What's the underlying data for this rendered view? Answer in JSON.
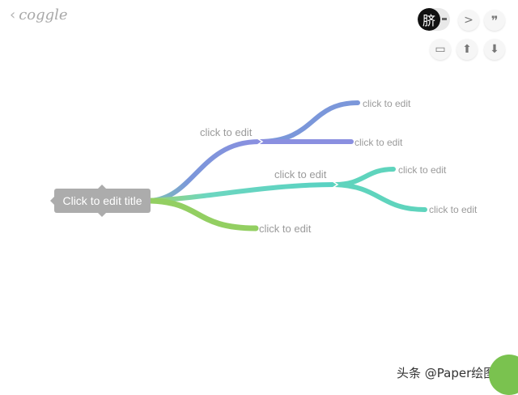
{
  "app": {
    "logo_text": "coggle",
    "back_icon": "chevron-left-icon"
  },
  "toolbar": {
    "avatar_glyph": "脐",
    "collapse_glyph": ">",
    "comment_glyph": "❞",
    "present_glyph": "▭",
    "upload_glyph": "⬆",
    "download_glyph": "⬇"
  },
  "mindmap": {
    "root": "Click to edit title",
    "nodes": {
      "branch_blue": "click to edit",
      "blue_child_1": "click to edit",
      "blue_child_2": "click to edit",
      "branch_teal": "click to edit",
      "teal_child_1": "click to edit",
      "teal_child_2": "click to edit",
      "branch_green": "click to edit"
    },
    "colors": {
      "blue": "#7b97da",
      "teal": "#5fd4bd",
      "green": "#93cf62",
      "root_bg": "#acacac"
    }
  },
  "watermark": {
    "text": "头条 @Paper绘图"
  }
}
